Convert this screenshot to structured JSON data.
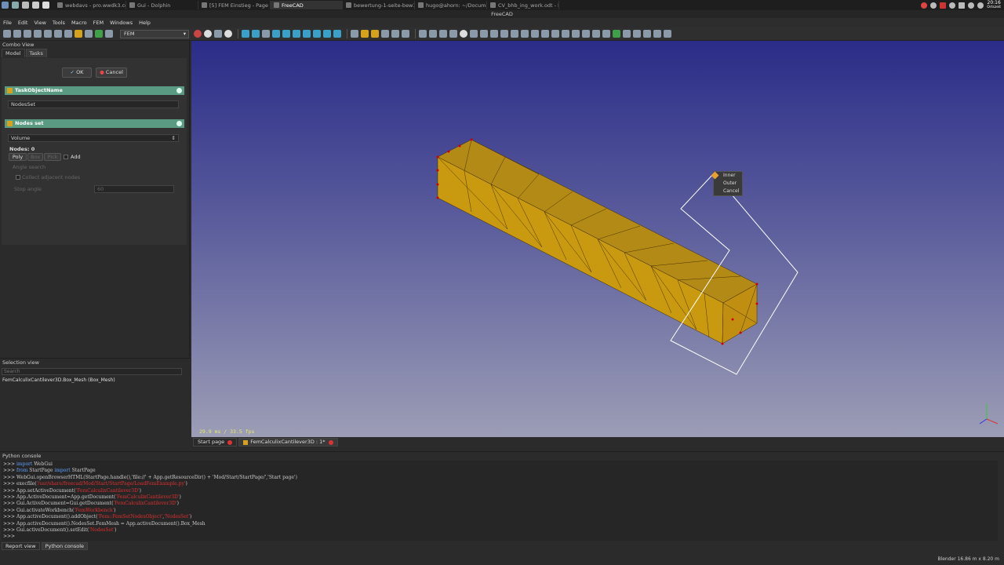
{
  "taskbar": {
    "tasks": [
      {
        "label": "webdavs - pro.wwdk3.com - I..."
      },
      {
        "label": "Gui - Dolphin"
      },
      {
        "label": "[5] FEM Einstieg - Page 3 - F..."
      },
      {
        "label": "FreeCAD",
        "active": true
      },
      {
        "label": "bewertung-1-seite-bew1-82..."
      },
      {
        "label": "hugo@ahorn: ~/Documents..."
      },
      {
        "label": "CV_bhb_ing_work.odt - Libre..."
      }
    ],
    "clock_time": "20:16",
    "clock_date": "Ortszeit"
  },
  "window_title": "FreeCAD",
  "menus": [
    "File",
    "Edit",
    "View",
    "Tools",
    "Macro",
    "FEM",
    "Windows",
    "Help"
  ],
  "workbench": "FEM",
  "combo": {
    "title": "Combo View",
    "tabs": [
      "Model",
      "Tasks"
    ],
    "ok": "OK",
    "cancel": "Cancel",
    "box1_title": "TaskObjectName",
    "object_name": "NodesSet",
    "box2_title": "Nodes set",
    "volume": "Volume",
    "nodes": "Nodes: 0",
    "poly": "Poly",
    "box": "Box",
    "pick": "Pick",
    "add": "Add",
    "angle_search": "Angle search",
    "collect": "Collect adjacent nodes",
    "stop_angle": "Stop angle",
    "stop_value": "60"
  },
  "selection": {
    "title": "Selection view",
    "search_placeholder": "Search",
    "item": "FemCalculixCantilever3D.Box_Mesh (Box_Mesh)"
  },
  "viewport": {
    "fps": "29.9 ms / 33.5 fps",
    "menu": [
      "Inner",
      "Outer",
      "Cancel"
    ]
  },
  "doctabs": [
    "Start page",
    "FemCalculixCantilever3D : 1*"
  ],
  "console": {
    "title": "Python console",
    "lines": [
      [
        [
          ">>> ",
          ""
        ],
        [
          "import",
          "kw"
        ],
        [
          " WebGui",
          ""
        ]
      ],
      [
        [
          ">>> ",
          ""
        ],
        [
          "from",
          "kw"
        ],
        [
          " StartPage ",
          ""
        ],
        [
          "import",
          "kw"
        ],
        [
          " StartPage",
          ""
        ]
      ],
      [
        [
          ">>> WebGui.openBrowserHTML(StartPage.handle(),",
          ""
        ],
        [
          "'file://'",
          ""
        ],
        [
          " + App.getResourceDir() + ",
          ""
        ],
        [
          "'Mod/Start/StartPage/'",
          ""
        ],
        [
          ",'Start page')",
          ""
        ]
      ],
      [
        [
          ">>> execfile(",
          ""
        ],
        [
          "'/usr/share/freecad/Mod/Start/StartPage/LoadFemExample.py'",
          "str"
        ],
        [
          ")",
          ""
        ]
      ],
      [
        [
          ">>> App.setActiveDocument(",
          ""
        ],
        [
          "'FemCalculixCantilever3D'",
          "str"
        ],
        [
          ")",
          ""
        ]
      ],
      [
        [
          ">>> App.ActiveDocument=App.getDocument(",
          ""
        ],
        [
          "'FemCalculixCantilever3D'",
          "str"
        ],
        [
          ")",
          ""
        ]
      ],
      [
        [
          ">>> Gui.ActiveDocument=Gui.getDocument(",
          ""
        ],
        [
          "'FemCalculixCantilever3D'",
          "str"
        ],
        [
          ")",
          ""
        ]
      ],
      [
        [
          ">>> Gui.activateWorkbench(",
          ""
        ],
        [
          "'FemWorkbench'",
          "str"
        ],
        [
          ")",
          ""
        ]
      ],
      [
        [
          ">>> App.activeDocument().addObject(",
          ""
        ],
        [
          "'Fem::FemSetNodesObject'",
          "str"
        ],
        [
          ",",
          ""
        ],
        [
          "'NodesSet'",
          "str"
        ],
        [
          ")",
          ""
        ]
      ],
      [
        [
          ">>> App.activeDocument().NodesSet.FemMesh = App.activeDocument().Box_Mesh",
          ""
        ]
      ],
      [
        [
          ">>> Gui.activeDocument().setEdit(",
          ""
        ],
        [
          "'NodesSet'",
          "str"
        ],
        [
          ")",
          ""
        ]
      ],
      [
        [
          ">>> ",
          ""
        ]
      ]
    ]
  },
  "bottom_tabs": [
    "Report view",
    "Python console"
  ],
  "status": "Blender  16.86 m x 8.20 m"
}
